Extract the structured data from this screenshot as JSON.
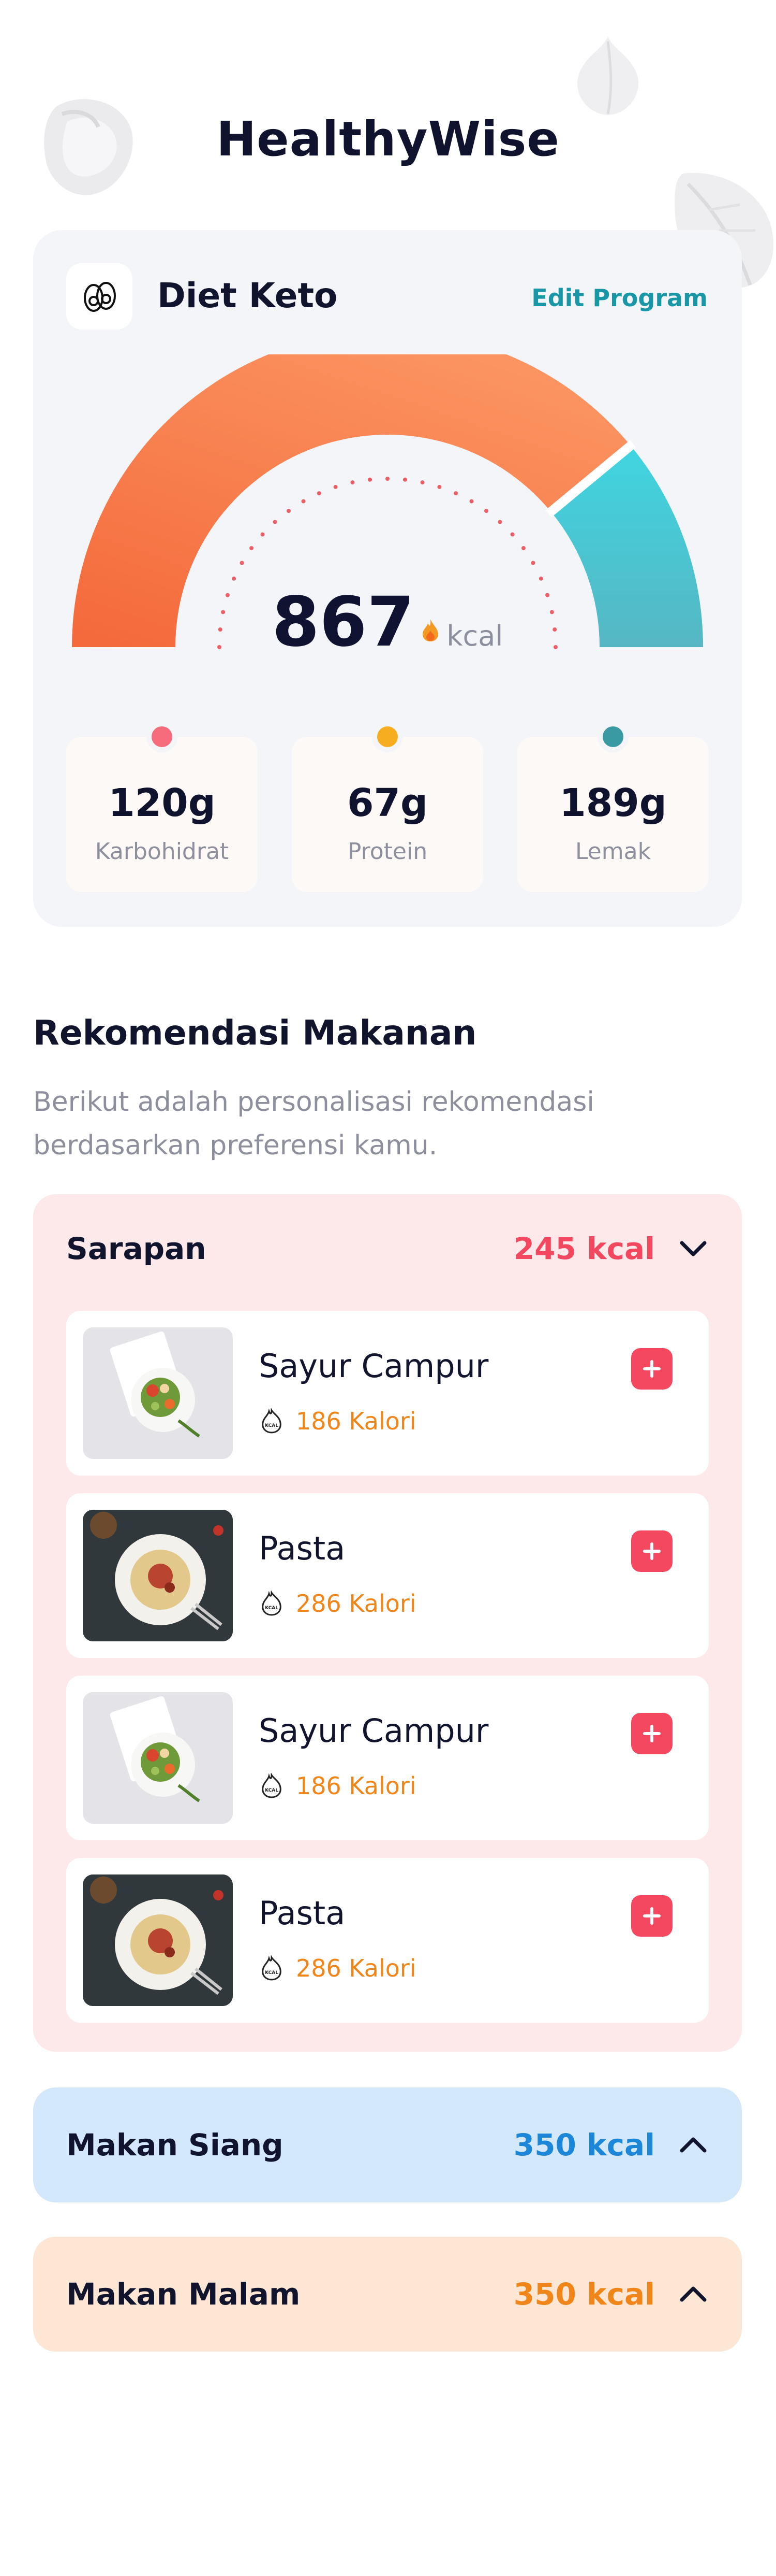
{
  "app": {
    "title": "HealthyWise"
  },
  "program": {
    "name": "Diet Keto",
    "edit_label": "Edit Program",
    "kcal_value": "867",
    "kcal_unit": "kcal",
    "gauge_progress": 0.78,
    "colors": {
      "consumed": "#f46a3b",
      "remaining": "#3fcbd8"
    },
    "macros": [
      {
        "value": "120g",
        "label": "Karbohidrat",
        "color": "#f56b7c"
      },
      {
        "value": "67g",
        "label": "Protein",
        "color": "#f6ad1f"
      },
      {
        "value": "189g",
        "label": "Lemak",
        "color": "#3a9aa3"
      }
    ]
  },
  "recommend": {
    "title": "Rekomendasi Makanan",
    "desc_line1": "Berikut adalah personalisasi rekomendasi",
    "desc_line2": "berdasarkan preferensi kamu."
  },
  "meals": [
    {
      "name": "Sarapan",
      "kcal": "245 kcal",
      "expanded": true,
      "bg": "#fde9ea",
      "accent": "#f2475e",
      "items": [
        {
          "name": "Sayur Campur",
          "calories": "186 Kalori",
          "image": "salad-image"
        },
        {
          "name": "Pasta",
          "calories": "286 Kalori",
          "image": "pasta-image"
        },
        {
          "name": "Sayur Campur",
          "calories": "186 Kalori",
          "image": "salad-image"
        },
        {
          "name": "Pasta",
          "calories": "286 Kalori",
          "image": "pasta-image"
        }
      ]
    },
    {
      "name": "Makan Siang",
      "kcal": "350 kcal",
      "expanded": false,
      "bg": "#d3e8fb",
      "accent": "#1c87d9"
    },
    {
      "name": "Makan Malam",
      "kcal": "350 kcal",
      "expanded": false,
      "bg": "#fde6d3",
      "accent": "#f0861a"
    }
  ]
}
